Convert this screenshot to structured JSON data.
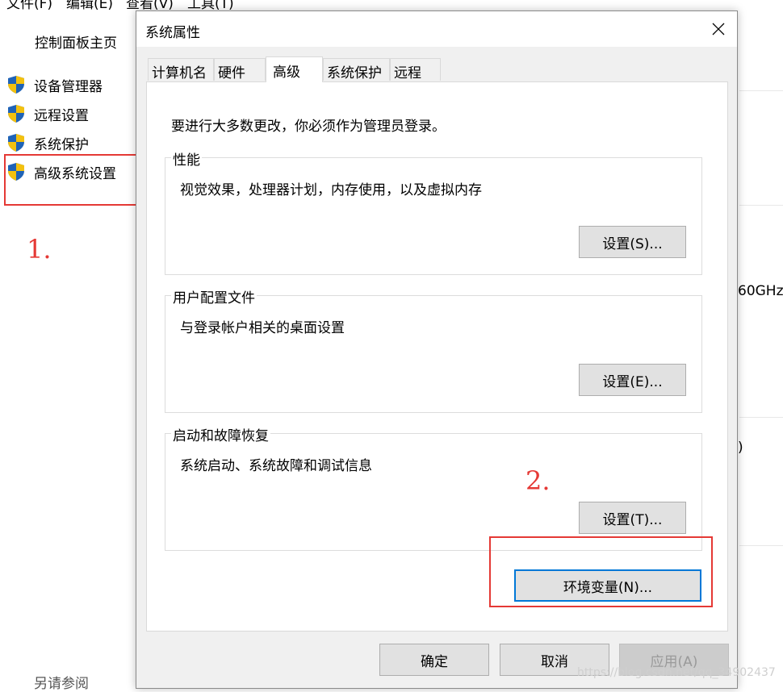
{
  "menubar": {
    "file": "文件(F)",
    "edit": "编辑(E)",
    "view": "查看(V)",
    "tools": "工具(T)"
  },
  "control_panel": {
    "home_link": "控制面板主页",
    "items": [
      {
        "label": "设备管理器",
        "icon": "shield-icon"
      },
      {
        "label": "远程设置",
        "icon": "shield-icon"
      },
      {
        "label": "系统保护",
        "icon": "shield-icon"
      },
      {
        "label": "高级系统设置",
        "icon": "shield-icon"
      }
    ],
    "see_also": "另请参阅",
    "right_fragments": {
      "cpu_speed": "60GHz",
      "paren": ")"
    }
  },
  "annotations": {
    "step1": "1.",
    "step2": "2.",
    "highlight_color": "#e53935"
  },
  "dialog": {
    "title": "系统属性",
    "close_icon": "close-icon",
    "tabs": [
      "计算机名",
      "硬件",
      "高级",
      "系统保护",
      "远程"
    ],
    "active_tab": "高级",
    "admin_notice": "要进行大多数更改，你必须作为管理员登录。",
    "groups": {
      "performance": {
        "legend": "性能",
        "description": "视觉效果，处理器计划，内存使用，以及虚拟内存",
        "button": "设置(S)..."
      },
      "user_profiles": {
        "legend": "用户配置文件",
        "description": "与登录帐户相关的桌面设置",
        "button": "设置(E)..."
      },
      "startup_recovery": {
        "legend": "启动和故障恢复",
        "description": "系统启动、系统故障和调试信息",
        "button": "设置(T)..."
      }
    },
    "env_button": "环境变量(N)...",
    "ok_button": "确定",
    "cancel_button": "取消",
    "apply_button": "应用(A)",
    "focus_color": "#0078d7"
  },
  "watermark": "https://blog.csdn.net/qq_34902437"
}
